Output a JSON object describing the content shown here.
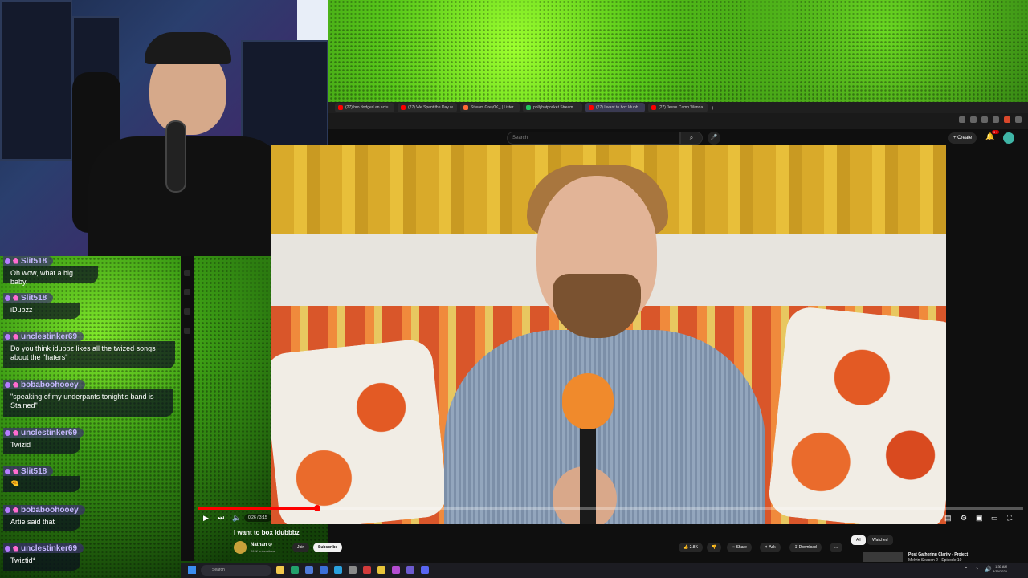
{
  "browser": {
    "tabs": [
      {
        "title": "(27) bro dodged an actu...",
        "color": "#ff0000",
        "active": false
      },
      {
        "title": "(27) We Spent the Day w...",
        "color": "#ff0000",
        "active": false
      },
      {
        "title": "Stream Grey0K_ | Lister",
        "color": "#ff6b35",
        "active": false
      },
      {
        "title": "pollyhatpocket Stream",
        "color": "#22c55e",
        "active": false
      },
      {
        "title": "(27) I want to box Idubb...",
        "color": "#ff0000",
        "active": true
      },
      {
        "title": "(27) Jesse Camp Wanna...",
        "color": "#ff0000",
        "active": false
      }
    ],
    "new_tab": "+"
  },
  "youtube": {
    "search_placeholder": "Search",
    "search_icon": "search-icon",
    "mic_icon": "microphone-icon",
    "create_label": "+ Create",
    "notif_count": "9+",
    "video": {
      "title": "I want to box Idubbbz",
      "time": "0:26 / 3:15",
      "progress": 0.145
    },
    "channel": {
      "name": "Nathan ⊙",
      "subscribers": "484K subscribers",
      "join": "Join",
      "subscribe": "Subscribe"
    },
    "actions": {
      "likes": "2.8K",
      "share": "Share",
      "ask": "Ask",
      "download": "Download",
      "more": "..."
    },
    "chips": [
      "All",
      "Watched"
    ],
    "recommended": {
      "title": "Post Gathering Clarity - Project",
      "subtitle": "Melvin Season 2 - Episode 10"
    }
  },
  "chat": [
    {
      "user": "Slit518",
      "text": "Oh wow, what a big baby."
    },
    {
      "user": "Slit518",
      "text": "iDubzz"
    },
    {
      "user": "unclestinker69",
      "text": "Do you think idubbz likes all the twized songs about the \"haters\""
    },
    {
      "user": "bobaboohooey",
      "text": "\"speaking of my underpants tonight's band is Stained\""
    },
    {
      "user": "unclestinker69",
      "text": "Twizid"
    },
    {
      "user": "Slit518",
      "text": "🤏"
    },
    {
      "user": "bobaboohooey",
      "text": "Artie said that"
    },
    {
      "user": "unclestinker69",
      "text": "Twiztid*"
    }
  ],
  "taskbar": {
    "search": "Search",
    "time": "1:30 AM",
    "date": "8/19/2025"
  }
}
